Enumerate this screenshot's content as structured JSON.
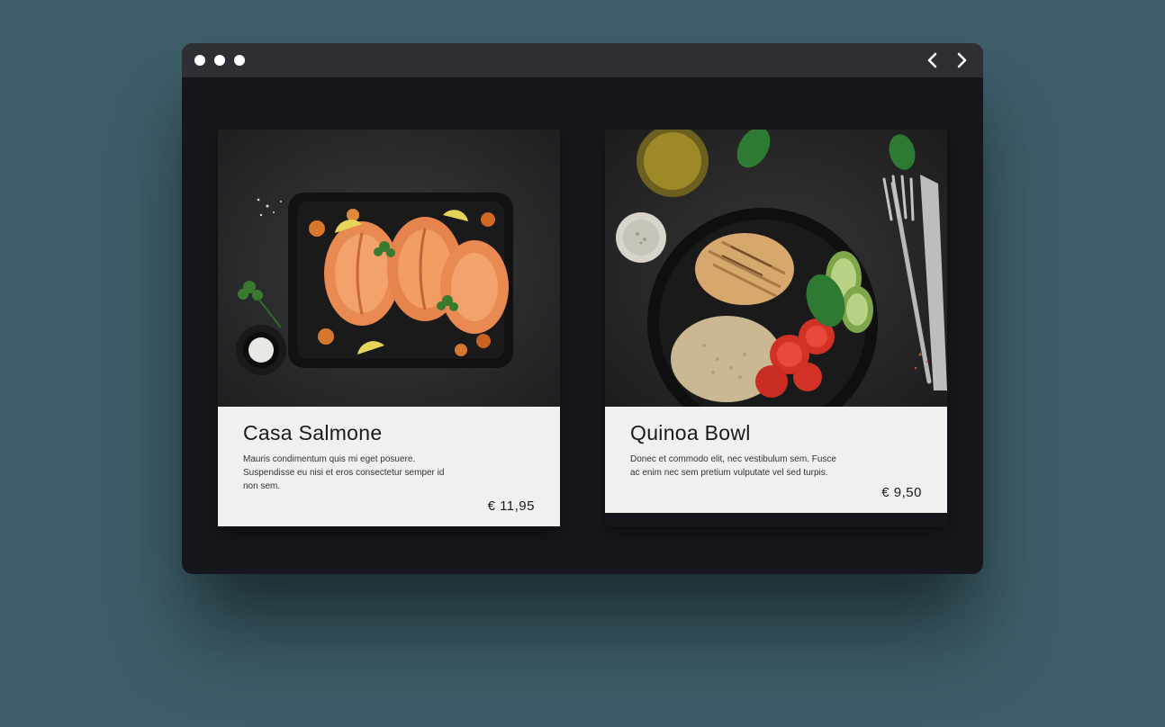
{
  "cards": [
    {
      "title": "Casa Salmone",
      "description": "Mauris condimentum quis mi eget posuere. Suspendisse eu nisi et eros consectetur semper id non sem.",
      "price": "€ 11,95",
      "image_alt": "salmon-dish"
    },
    {
      "title": "Quinoa Bowl",
      "description": "Donec et commodo elit, nec vestibulum sem. Fusce ac enim nec sem pretium vulputate vel sed turpis.",
      "price": "€ 9,50",
      "image_alt": "quinoa-bowl-dish"
    }
  ]
}
